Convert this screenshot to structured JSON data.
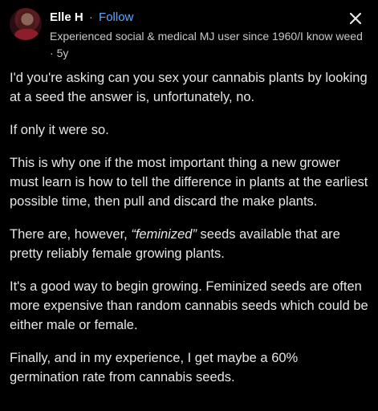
{
  "header": {
    "author": "Elle H",
    "separator": "·",
    "follow_label": "Follow",
    "credential": "Experienced social & medical MJ user since 1960/I know weed",
    "age_separator": "·",
    "age": "5y",
    "close_icon": "close-icon"
  },
  "post": {
    "p1": "I'd you're asking can you sex your cannabis plants by looking at a seed the answer is, unfortunately, no.",
    "p2": "If only it were so.",
    "p3": "This is why one if the most important thing a new grower must learn is how to tell the difference in plants at the earliest possible time, then pull and discard the make plants.",
    "p4_before": "There are, however, ",
    "p4_emphasis": "“feminized”",
    "p4_after": " seeds available that are pretty reliably female growing plants.",
    "p5": "It's a good way to begin growing. Feminized seeds are often more expensive than random cannabis seeds which could be either male or female.",
    "p6": "Finally, and in my experience, I get maybe a 60% germination rate from cannabis seeds."
  },
  "colors": {
    "background": "#000000",
    "text": "#e6e6e6",
    "follow_link": "#5fa8ff",
    "meta_text": "#c8c8c8"
  }
}
